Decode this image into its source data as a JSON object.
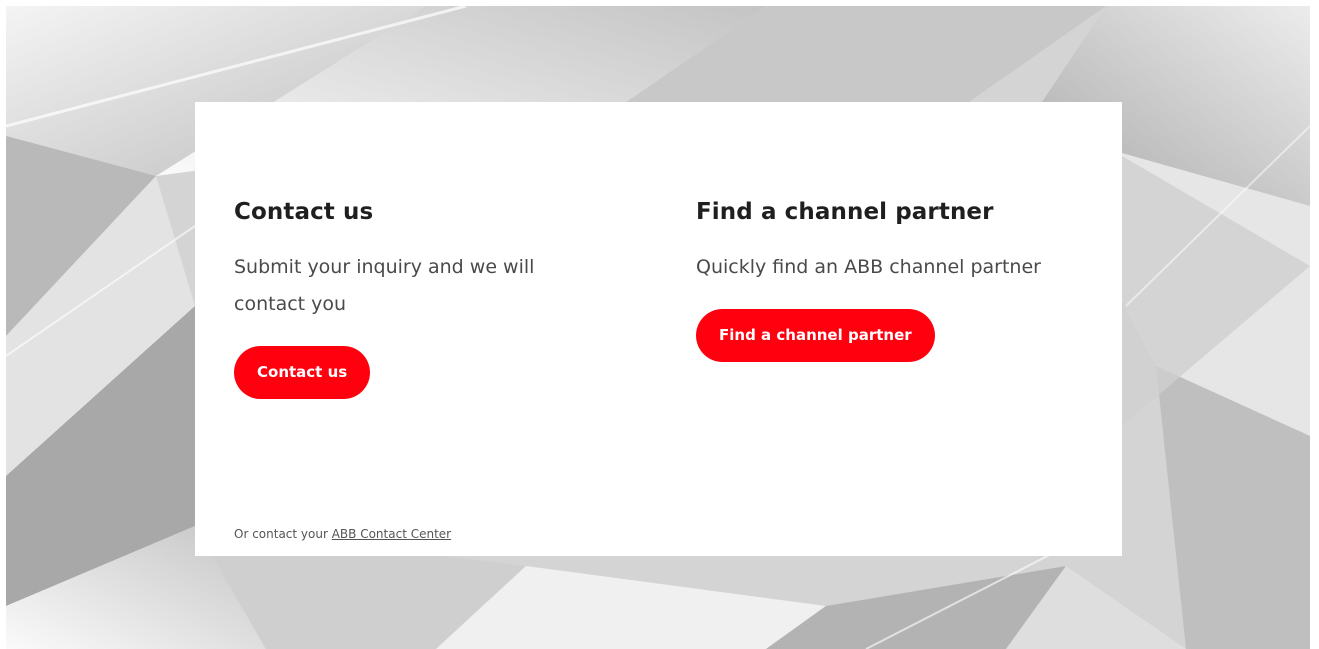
{
  "colors": {
    "accent": "#ff000f",
    "heading": "#1f1f1f",
    "body_text": "#4a4a4a",
    "card_bg": "#ffffff"
  },
  "contact": {
    "title": "Contact us",
    "description": "Submit your inquiry and we will contact you",
    "button_label": "Contact us"
  },
  "partner": {
    "title": "Find a channel partner",
    "description": "Quickly find an ABB channel partner",
    "button_label": "Find a channel partner"
  },
  "footer": {
    "prefix": "Or contact your ",
    "link_label": "ABB Contact Center"
  }
}
